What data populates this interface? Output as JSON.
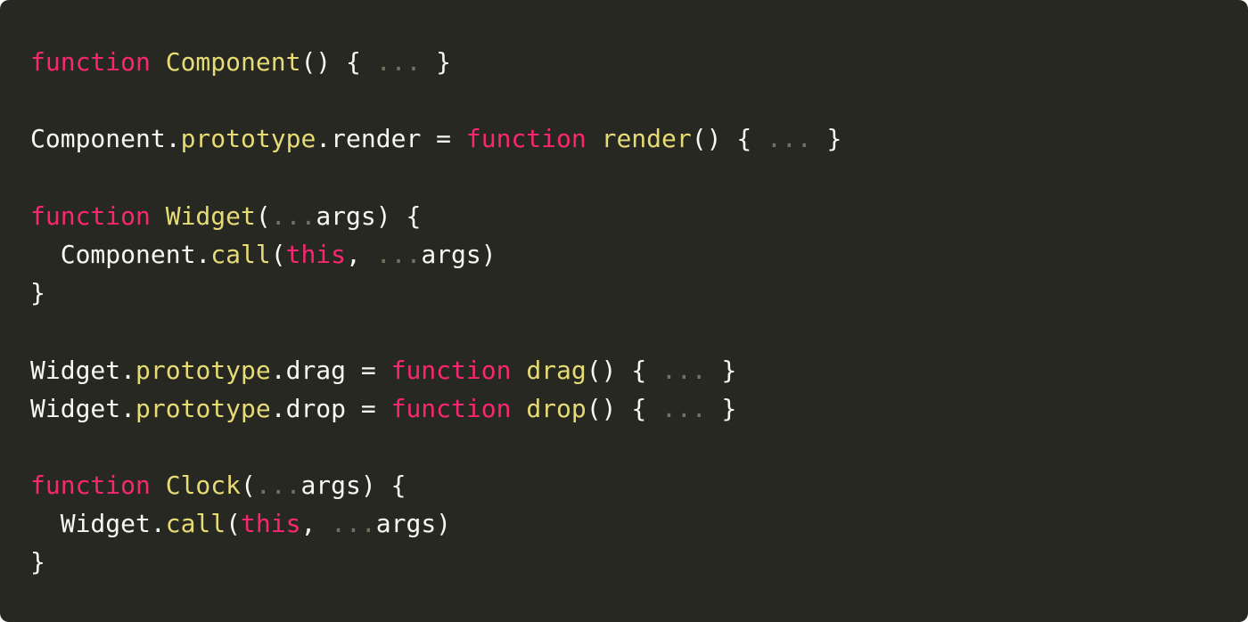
{
  "colors": {
    "background": "#272822",
    "keyword": "#f92672",
    "name": "#e6db74",
    "property": "#e6db74",
    "ellipsis": "#75715e",
    "plain": "#f8f8f2"
  },
  "code": {
    "lines": [
      [
        {
          "text": "function",
          "type": "keyword"
        },
        {
          "text": " ",
          "type": "plain"
        },
        {
          "text": "Component",
          "type": "name"
        },
        {
          "text": "() { ",
          "type": "plain"
        },
        {
          "text": "...",
          "type": "ellipsis"
        },
        {
          "text": " }",
          "type": "plain"
        }
      ],
      [],
      [
        {
          "text": "Component.",
          "type": "plain"
        },
        {
          "text": "prototype",
          "type": "prop"
        },
        {
          "text": ".render = ",
          "type": "plain"
        },
        {
          "text": "function",
          "type": "keyword"
        },
        {
          "text": " ",
          "type": "plain"
        },
        {
          "text": "render",
          "type": "name"
        },
        {
          "text": "() { ",
          "type": "plain"
        },
        {
          "text": "...",
          "type": "ellipsis"
        },
        {
          "text": " }",
          "type": "plain"
        }
      ],
      [],
      [
        {
          "text": "function",
          "type": "keyword"
        },
        {
          "text": " ",
          "type": "plain"
        },
        {
          "text": "Widget",
          "type": "name"
        },
        {
          "text": "(",
          "type": "plain"
        },
        {
          "text": "...",
          "type": "ellipsis"
        },
        {
          "text": "args) {",
          "type": "plain"
        }
      ],
      [
        {
          "text": "  Component.",
          "type": "plain"
        },
        {
          "text": "call",
          "type": "prop"
        },
        {
          "text": "(",
          "type": "plain"
        },
        {
          "text": "this",
          "type": "this"
        },
        {
          "text": ", ",
          "type": "plain"
        },
        {
          "text": "...",
          "type": "ellipsis"
        },
        {
          "text": "args)",
          "type": "plain"
        }
      ],
      [
        {
          "text": "}",
          "type": "plain"
        }
      ],
      [],
      [
        {
          "text": "Widget.",
          "type": "plain"
        },
        {
          "text": "prototype",
          "type": "prop"
        },
        {
          "text": ".drag = ",
          "type": "plain"
        },
        {
          "text": "function",
          "type": "keyword"
        },
        {
          "text": " ",
          "type": "plain"
        },
        {
          "text": "drag",
          "type": "name"
        },
        {
          "text": "() { ",
          "type": "plain"
        },
        {
          "text": "...",
          "type": "ellipsis"
        },
        {
          "text": " }",
          "type": "plain"
        }
      ],
      [
        {
          "text": "Widget.",
          "type": "plain"
        },
        {
          "text": "prototype",
          "type": "prop"
        },
        {
          "text": ".drop = ",
          "type": "plain"
        },
        {
          "text": "function",
          "type": "keyword"
        },
        {
          "text": " ",
          "type": "plain"
        },
        {
          "text": "drop",
          "type": "name"
        },
        {
          "text": "() { ",
          "type": "plain"
        },
        {
          "text": "...",
          "type": "ellipsis"
        },
        {
          "text": " }",
          "type": "plain"
        }
      ],
      [],
      [
        {
          "text": "function",
          "type": "keyword"
        },
        {
          "text": " ",
          "type": "plain"
        },
        {
          "text": "Clock",
          "type": "name"
        },
        {
          "text": "(",
          "type": "plain"
        },
        {
          "text": "...",
          "type": "ellipsis"
        },
        {
          "text": "args) {",
          "type": "plain"
        }
      ],
      [
        {
          "text": "  Widget.",
          "type": "plain"
        },
        {
          "text": "call",
          "type": "prop"
        },
        {
          "text": "(",
          "type": "plain"
        },
        {
          "text": "this",
          "type": "this"
        },
        {
          "text": ", ",
          "type": "plain"
        },
        {
          "text": "...",
          "type": "ellipsis"
        },
        {
          "text": "args)",
          "type": "plain"
        }
      ],
      [
        {
          "text": "}",
          "type": "plain"
        }
      ]
    ]
  }
}
